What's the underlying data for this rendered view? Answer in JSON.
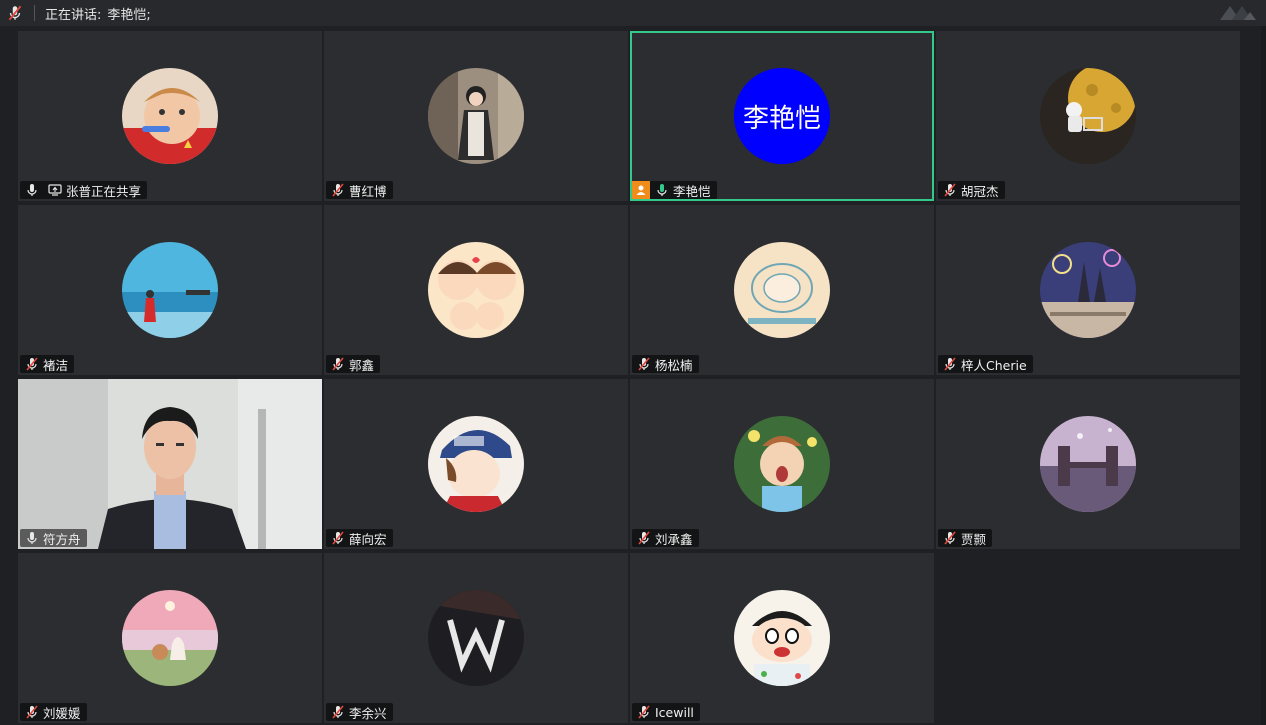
{
  "topbar": {
    "speaking_label": "正在讲话:",
    "speaking_name": "李艳恺;"
  },
  "participants": [
    {
      "name": "张普正在共享",
      "mic": "on",
      "sharing": true
    },
    {
      "name": "曹红博",
      "mic": "muted"
    },
    {
      "name": "李艳恺",
      "mic": "active",
      "host": true,
      "avatar_text": "李艳恺",
      "avatar_color": "#0000ff"
    },
    {
      "name": "胡冠杰",
      "mic": "muted"
    },
    {
      "name": "褚洁",
      "mic": "muted"
    },
    {
      "name": "郭鑫",
      "mic": "muted"
    },
    {
      "name": "杨松楠",
      "mic": "muted"
    },
    {
      "name": "梓人Cherie",
      "mic": "muted"
    },
    {
      "name": "符方舟",
      "mic": "on",
      "video": true
    },
    {
      "name": "薛向宏",
      "mic": "muted"
    },
    {
      "name": "刘承鑫",
      "mic": "muted"
    },
    {
      "name": "贾颢",
      "mic": "muted"
    },
    {
      "name": "刘媛媛",
      "mic": "muted"
    },
    {
      "name": "李余兴",
      "mic": "muted"
    },
    {
      "name": "Icewill",
      "mic": "muted"
    }
  ],
  "colors": {
    "active_border": "#33c98b",
    "host_badge": "#f08c1a",
    "muted_slash": "#e0483e"
  }
}
